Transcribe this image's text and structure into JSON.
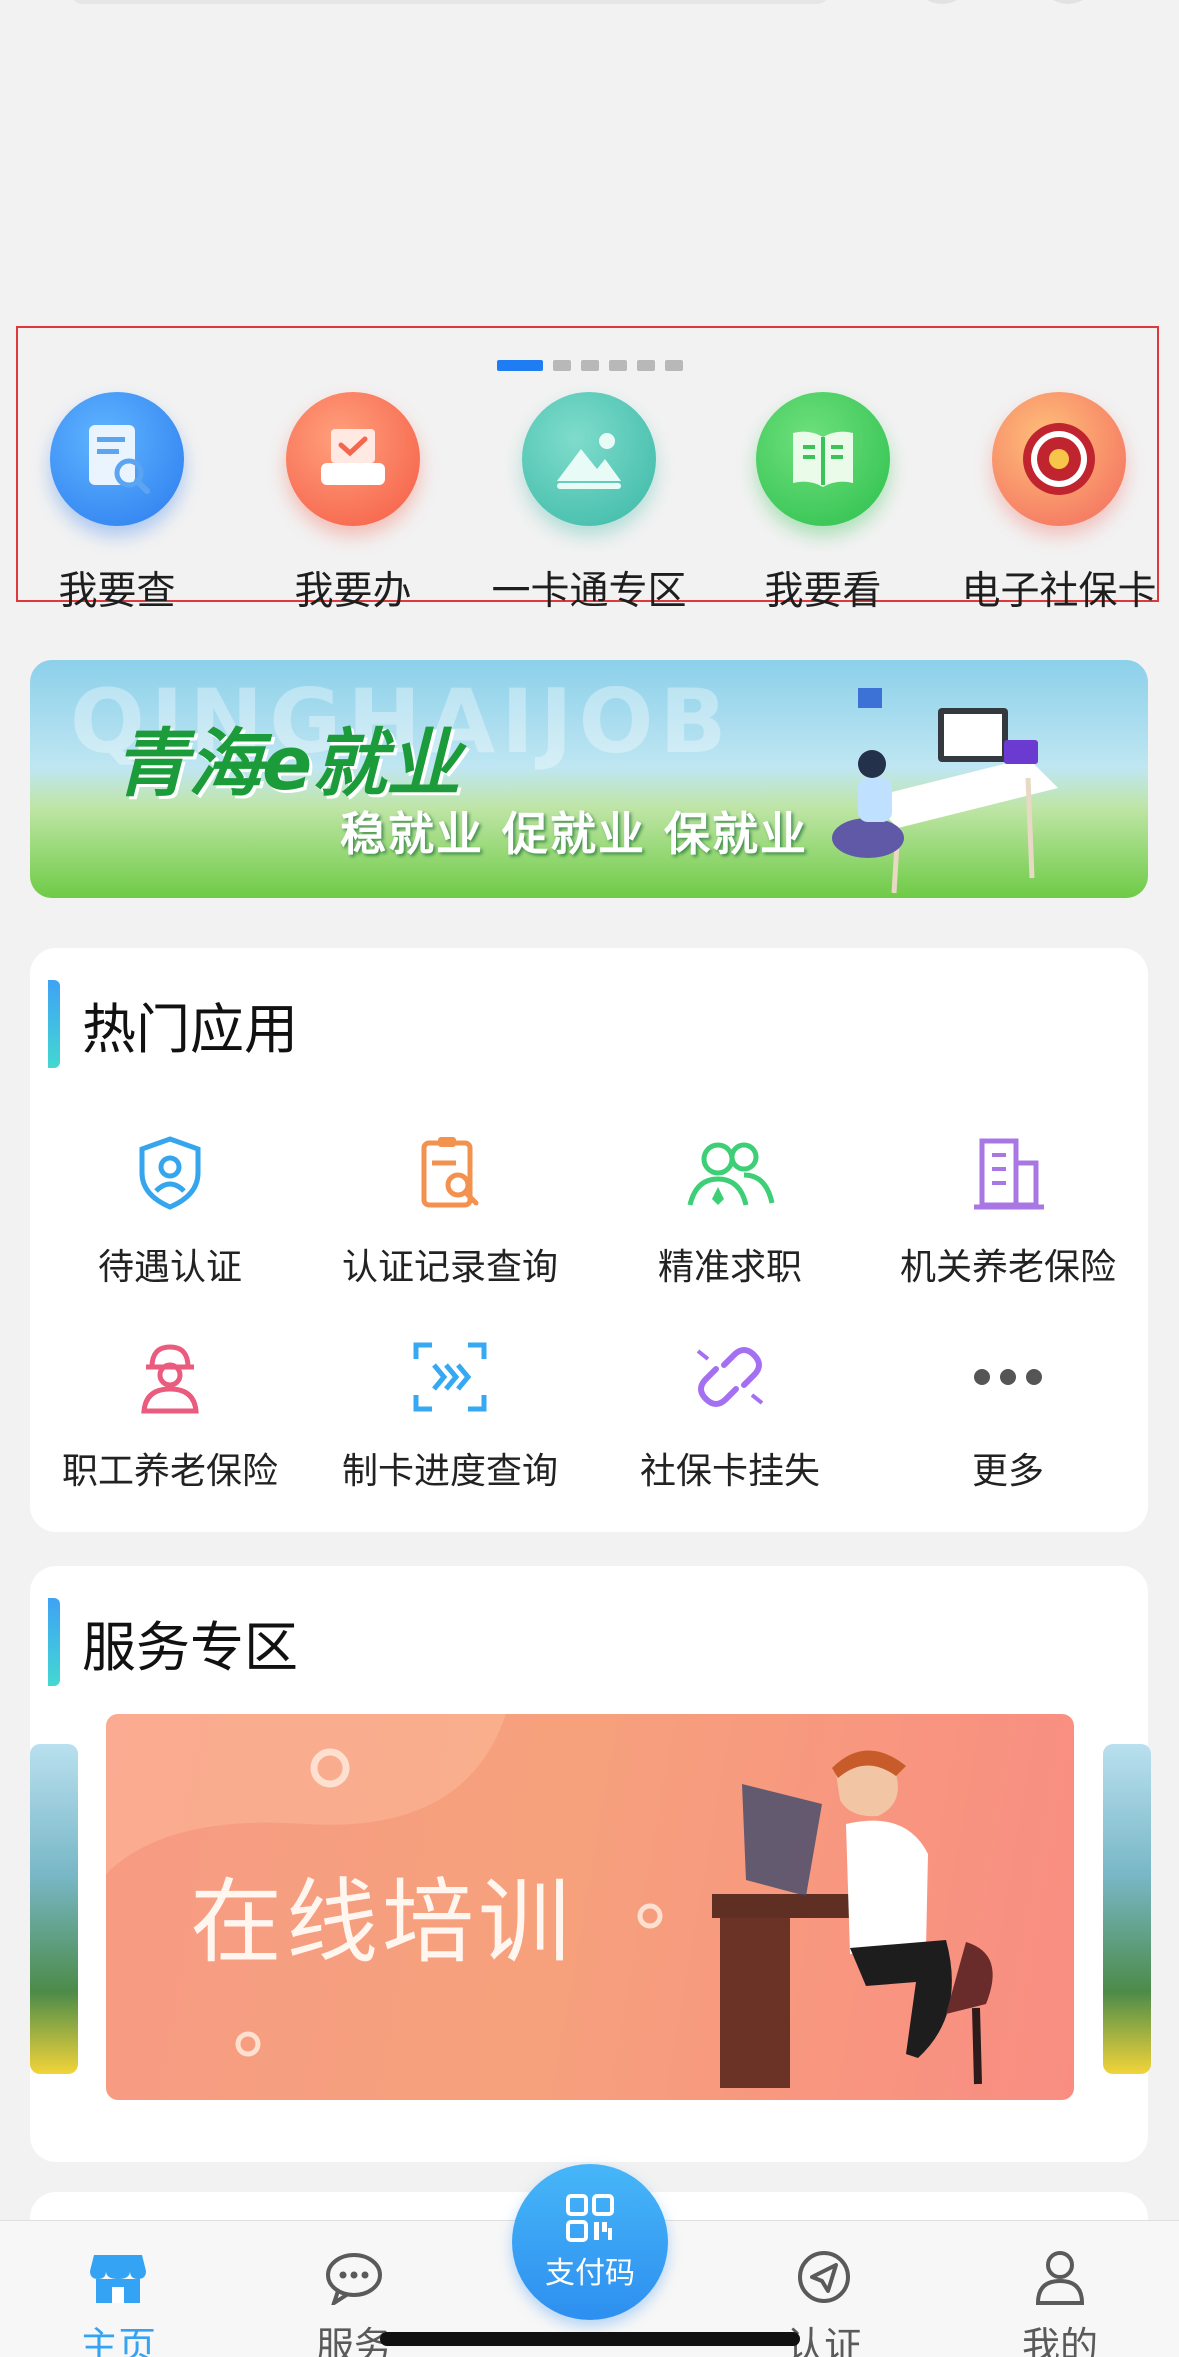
{
  "quick_entries": {
    "pager_count": 6,
    "pager_active_index": 0,
    "items": [
      {
        "label": "我要查",
        "icon": "search-document-icon",
        "color": "#2f7ff0"
      },
      {
        "label": "我要办",
        "icon": "print-task-icon",
        "color": "#fb6f52"
      },
      {
        "label": "一卡通专区",
        "icon": "picture-card-icon",
        "color": "#45c3b2"
      },
      {
        "label": "我要看",
        "icon": "open-book-icon",
        "color": "#33c65a"
      },
      {
        "label": "电子社保卡",
        "icon": "social-security-seal-icon",
        "color": "#f58a63"
      }
    ]
  },
  "banner": {
    "watermark": "QINGHAIJOB",
    "title": "青海e就业",
    "slogan": "稳就业 促就业 保就业"
  },
  "hot_apps": {
    "heading": "热门应用",
    "items": [
      {
        "label": "待遇认证",
        "icon": "shield-user-icon",
        "color": "#35a6ee"
      },
      {
        "label": "认证记录查询",
        "icon": "clipboard-search-icon",
        "color": "#f3914f"
      },
      {
        "label": "精准求职",
        "icon": "people-icon",
        "color": "#3ccf76"
      },
      {
        "label": "机关养老保险",
        "icon": "building-icon",
        "color": "#a877e3"
      },
      {
        "label": "职工养老保险",
        "icon": "worker-icon",
        "color": "#ea5b7e"
      },
      {
        "label": "制卡进度查询",
        "icon": "card-progress-icon",
        "color": "#36a9f2"
      },
      {
        "label": "社保卡挂失",
        "icon": "broken-link-icon",
        "color": "#a46ff0"
      },
      {
        "label": "更多",
        "icon": "more-dots-icon",
        "color": "#555555"
      }
    ]
  },
  "service_zone": {
    "heading": "服务专区",
    "main_card": "在线培训"
  },
  "tabbar": {
    "tabs": [
      {
        "label": "主页",
        "icon": "store-icon",
        "active": true
      },
      {
        "label": "服务",
        "icon": "chat-bubble-icon",
        "active": false
      },
      {
        "label": "认证",
        "icon": "navigation-arrow-icon",
        "active": false
      },
      {
        "label": "我的",
        "icon": "person-icon",
        "active": false
      }
    ],
    "pay_button": {
      "label": "支付码",
      "icon": "qr-code-icon"
    }
  }
}
